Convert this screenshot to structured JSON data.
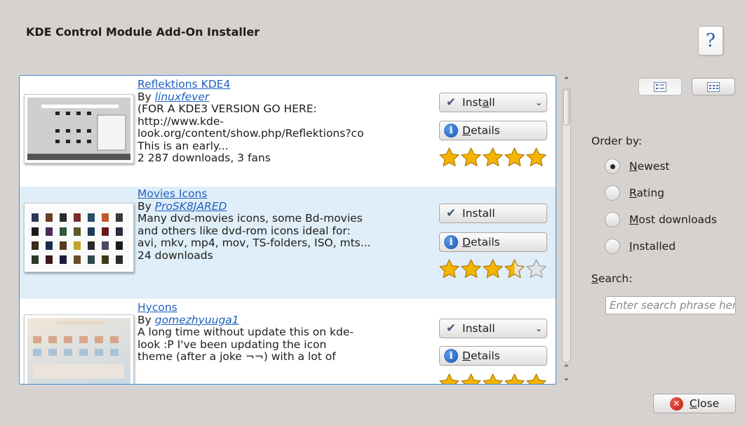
{
  "dialog": {
    "title": "KDE Control Module Add-On Installer",
    "help_icon": "help-icon"
  },
  "items": [
    {
      "name": "Reflektions KDE4",
      "by_prefix": "By ",
      "author": "linuxfever",
      "description": "(FOR A KDE3 VERSION GO HERE:\nhttp://www.kde-\nlook.org/content/show.php/Reflektions?co\nThis is an early...",
      "downloads": "2 287 downloads, 3 fans",
      "install_label": "Install",
      "details_label": "Details",
      "rating_stars": 5
    },
    {
      "name": "Movies Icons",
      "by_prefix": "By ",
      "author": "ProSK8JARED",
      "description": "Many dvd-movies icons, some Bd-movies\nand others like dvd-rom icons ideal for:\navi, mkv, mp4, mov, TS-folders, ISO, mts...",
      "downloads": "24 downloads",
      "install_label": "Install",
      "details_label": "Details",
      "rating_stars": 3.5
    },
    {
      "name": "Hycons",
      "by_prefix": "By ",
      "author": "gomezhyuuga1",
      "description": "A long time without update this on kde-\nlook :P I've been updating the icon\ntheme (after a joke ¬¬) with a lot of",
      "downloads": "",
      "install_label": "Install",
      "details_label": "Details",
      "rating_stars": 5
    }
  ],
  "sidebar": {
    "order_label": "Order by:",
    "order_options": [
      "Newest",
      "Rating",
      "Most downloads",
      "Installed"
    ],
    "selected_order": "Newest",
    "search_label": "Search:",
    "search_placeholder": "Enter search phrase here",
    "search_value": ""
  },
  "footer": {
    "close_label": "Close"
  },
  "colors": {
    "accent": "#3f8fd5",
    "link": "#2060c0",
    "alt_row": "#dfeef8",
    "star": "#f5b400"
  }
}
